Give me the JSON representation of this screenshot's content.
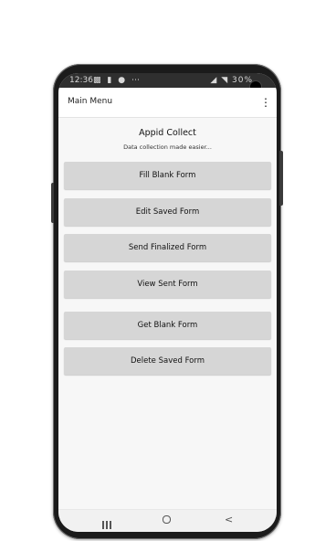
{
  "status_bar": {
    "time": "12:36",
    "left_icons": [
      "notification-icon",
      "message-icon",
      "location-icon",
      "more-dots-icon"
    ],
    "right_text": "◢ ◥ 30%"
  },
  "action_bar": {
    "title": "Main Menu",
    "overflow_menu": "⋮"
  },
  "app": {
    "title": "Appid Collect",
    "subtitle": "Data collection made easier..."
  },
  "buttons": [
    {
      "label": "Fill Blank Form"
    },
    {
      "label": "Edit Saved Form"
    },
    {
      "label": "Send Finalized Form"
    },
    {
      "label": "View Sent Form"
    },
    {
      "label": "Get Blank Form"
    },
    {
      "label": "Delete Saved Form"
    }
  ],
  "nav_bar": {
    "back": "<"
  },
  "colors": {
    "button_bg": "#d6d6d6",
    "screen_bg": "#f7f7f7",
    "status_bar_bg": "#2f2f2f",
    "phone_body": "#1b1b1b"
  }
}
